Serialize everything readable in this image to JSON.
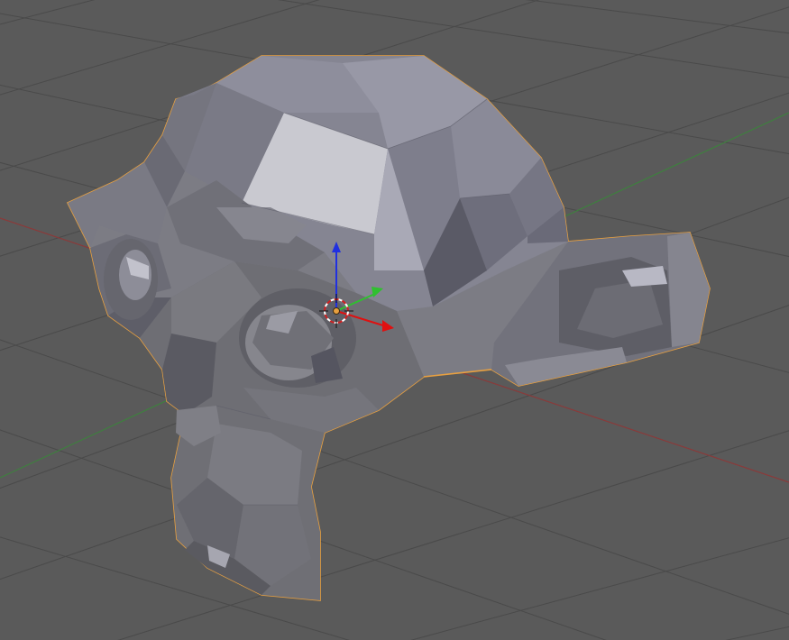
{
  "viewport": {
    "object_name": "",
    "colors": {
      "background": "#5a5a5a",
      "grid_line": "#4b4b4b",
      "x_axis": "#8a3a3a",
      "y_axis": "#3f7f3f",
      "mesh_outline_selected": "#e8a040",
      "gizmo_x": "#e01010",
      "gizmo_y": "#30c030",
      "gizmo_z": "#2030e0"
    },
    "icons": [
      "3d-cursor-icon",
      "transform-gizmo-icon"
    ],
    "object": "suzanne-monkey-mesh",
    "selected": true,
    "grid_visible": true
  }
}
